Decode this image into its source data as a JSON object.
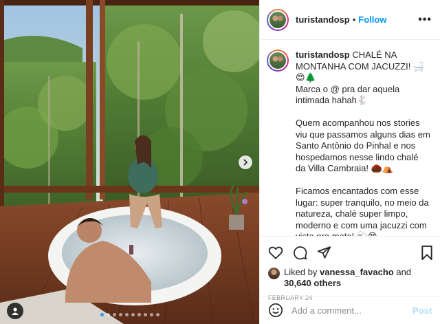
{
  "post": {
    "username": "turistandosp",
    "follow_label": "Follow",
    "separator": "•",
    "more_label": "•••",
    "caption_text": " CHALÉ NA MONTANHA COM JACUZZI! 🛁😍🌲\nMarca o @ pra dar aquela intimada hahah🐇\n\nQuem acompanhou nos stories viu que passamos alguns dias em Santo Antônio do Pinhal e nos hospedamos nesse lindo chalé da Villa Cambraia! 🌰⛺\n\nFicamos encantados com esse lugar: super tranquilo, no meio da natureza, chalé super limpo, moderno e com uma jacuzzi com vista pra mata! 🐑😍\nAlém da jacuzzi, tem lareira, um chuveiro muito bom e cozinha completinha pra preparar as refeições",
    "liked_by_prefix": "Liked by ",
    "liked_by_user": "vanessa_favacho",
    "liked_by_and": " and",
    "likes_count": "30,640 others",
    "date": "FEBRUARY 24",
    "comment_placeholder": "Add a comment...",
    "post_label": "Post"
  },
  "carousel": {
    "total_slides": 10,
    "active_slide": 1
  },
  "icons": {
    "next": "chevron-right-icon",
    "tag": "user-tag-icon",
    "like": "heart-icon",
    "comment": "comment-icon",
    "share": "paper-plane-icon",
    "save": "bookmark-icon",
    "emoji": "smiley-icon"
  },
  "colors": {
    "link_blue": "#0095f6",
    "post_disabled": "#b2dffc",
    "muted": "#8e8e8e",
    "text": "#262626"
  }
}
